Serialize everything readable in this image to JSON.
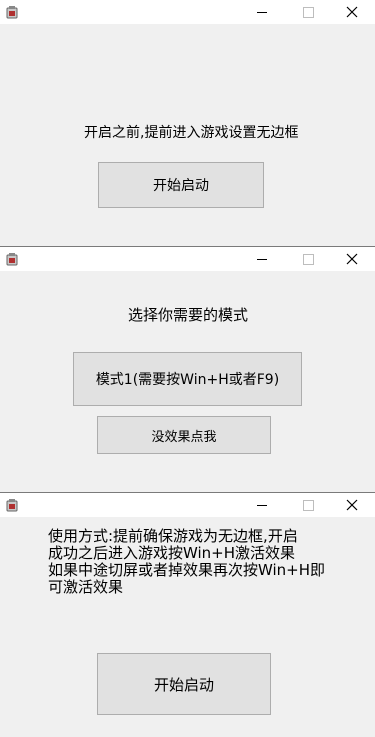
{
  "windows": [
    {
      "label": "开启之前,提前进入游戏设置无边框",
      "buttons": [
        "开始启动"
      ]
    },
    {
      "label": "选择你需要的模式",
      "buttons": [
        "模式1(需要按Win+H或者F9)",
        "没效果点我"
      ]
    },
    {
      "usage_text": "使用方式:提前确保游戏为无边框,开启\n成功之后进入游戏按Win+H激活效果\n如果中途切屏或者掉效果再次按Win+H即\n可激活效果",
      "buttons": [
        "开始启动"
      ]
    }
  ],
  "titlebar_controls": {
    "minimize": "minimize-icon",
    "maximize": "maximize-icon",
    "close": "close-icon"
  }
}
